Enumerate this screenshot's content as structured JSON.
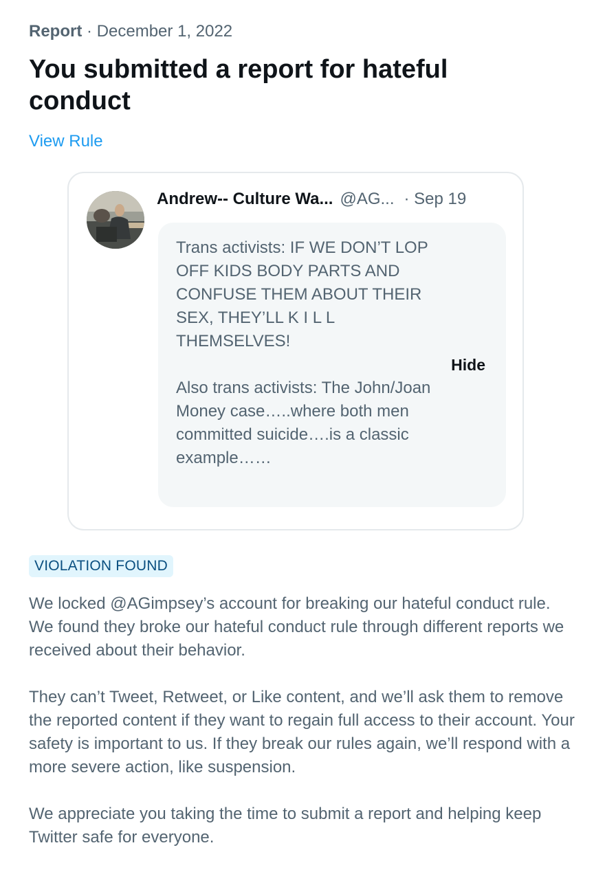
{
  "report": {
    "label": "Report",
    "separator": "·",
    "date": "December 1, 2022",
    "headline": "You submitted a report for hateful conduct",
    "view_rule_label": "View Rule"
  },
  "tweet": {
    "author_name": "Andrew-- Culture Wa...",
    "author_handle": "@AG...",
    "date": "· Sep 19",
    "paragraph1": "Trans activists: IF WE DON’T LOP OFF KIDS BODY PARTS AND CONFUSE THEM ABOUT THEIR SEX, THEY’LL K I L L THEMSELVES!",
    "paragraph2": "Also trans activists: The John/Joan Money case…..where both men committed suicide….is a classic example……",
    "hide_label": "Hide"
  },
  "result": {
    "badge": "VIOLATION FOUND",
    "paragraph1": "We locked @AGimpsey’s account for breaking our hateful conduct rule. We found they broke our hateful conduct rule through different reports we received about their behavior.",
    "paragraph2": "They can’t Tweet, Retweet, or Like content, and we’ll ask them to remove the reported content if they want to regain full access to their account. Your safety is important to us. If they break our rules again, we’ll respond with a more severe action, like suspension.",
    "paragraph3": "We appreciate you taking the time to submit a report and helping keep Twitter safe for everyone."
  },
  "colors": {
    "link": "#1d9bf0",
    "secondary_text": "#536471",
    "primary_text": "#0f1419",
    "badge_bg": "#e1f5fd",
    "badge_text": "#0a4f80",
    "tweet_body_bg": "#f4f7f8",
    "card_border": "#e5e9ec"
  },
  "icons": {
    "avatar": "profile-photo"
  }
}
